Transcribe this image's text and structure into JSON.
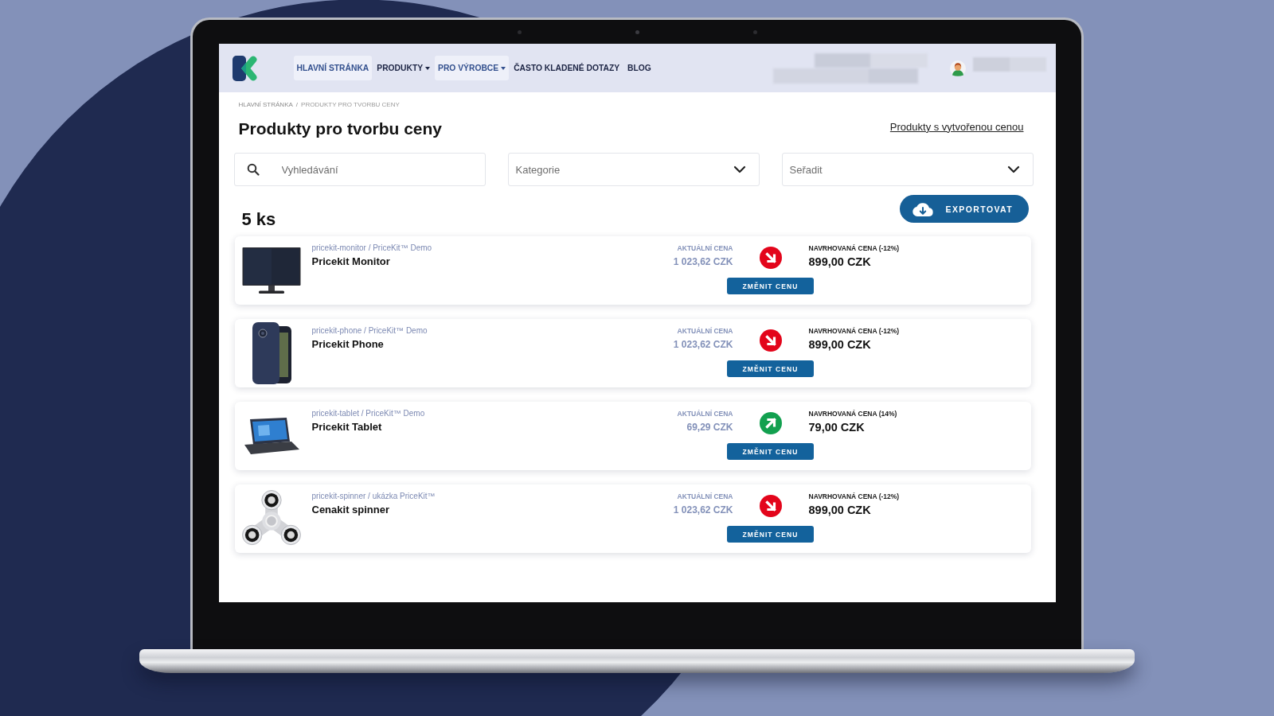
{
  "header": {
    "nav": [
      {
        "label": "HLAVNÍ STRÁNKA",
        "selected": true,
        "dropdown": false
      },
      {
        "label": "PRODUKTY",
        "selected": false,
        "dropdown": true
      },
      {
        "label": "PRO VÝROBCE",
        "selected": true,
        "dropdown": true
      },
      {
        "label": "ČASTO KLADENÉ DOTAZY",
        "selected": false,
        "dropdown": false
      },
      {
        "label": "BLOG",
        "selected": false,
        "dropdown": false
      }
    ]
  },
  "breadcrumb": {
    "items": [
      "HLAVNÍ STRÁNKA",
      "PRODUKTY PRO TVORBU CENY"
    ],
    "separator": "/"
  },
  "title": "Produkty pro tvorbu ceny",
  "header_link": "Produkty s vytvořenou cenou",
  "filters": {
    "search": {
      "placeholder": "Vyhledávání"
    },
    "category": {
      "placeholder": "Kategorie"
    },
    "sort": {
      "placeholder": "Seřadit"
    }
  },
  "count": "5 ks",
  "export_button": "EXPORTOVAT",
  "products": [
    {
      "kind": "monitor",
      "slug": "pricekit-monitor / PriceKit™ Demo",
      "name": "Pricekit Monitor",
      "current_label": "AKTUÁLNÍ CENA",
      "current_price": "1 023,62 CZK",
      "trend": {
        "kind": "down",
        "color": "#e3051b"
      },
      "suggested_label": "NAVRHOVANÁ CENA (-12%)",
      "suggested_price": "899,00 CZK",
      "button": "ZMĚNIT CENU"
    },
    {
      "kind": "phone",
      "slug": "pricekit-phone / PriceKit™ Demo",
      "name": "Pricekit Phone",
      "current_label": "AKTUÁLNÍ CENA",
      "current_price": "1 023,62 CZK",
      "trend": {
        "kind": "down",
        "color": "#e3051b"
      },
      "suggested_label": "NAVRHOVANÁ CENA (-12%)",
      "suggested_price": "899,00 CZK",
      "button": "ZMĚNIT CENU"
    },
    {
      "kind": "tablet",
      "slug": "pricekit-tablet / PriceKit™ Demo",
      "name": "Pricekit Tablet",
      "current_label": "AKTUÁLNÍ CENA",
      "current_price": "69,29 CZK",
      "trend": {
        "kind": "up",
        "color": "#12a04f"
      },
      "suggested_label": "NAVRHOVANÁ CENA (14%)",
      "suggested_price": "79,00 CZK",
      "button": "ZMĚNIT CENU"
    },
    {
      "kind": "spinner",
      "slug": "pricekit-spinner / ukázka PriceKit™",
      "name": "Cenakit spinner",
      "current_label": "AKTUÁLNÍ CENA",
      "current_price": "1 023,62 CZK",
      "trend": {
        "kind": "down",
        "color": "#e3051b"
      },
      "suggested_label": "NAVRHOVANÁ CENA (-12%)",
      "suggested_price": "899,00 CZK",
      "button": "ZMĚNIT CENU"
    }
  ]
}
